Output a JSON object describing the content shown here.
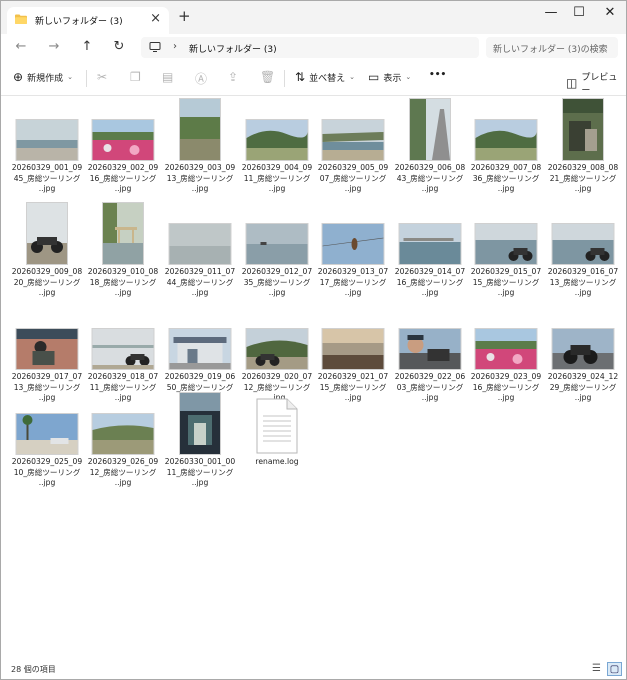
{
  "window": {
    "tab_title": "新しいフォルダー (3)",
    "new_tab": "+",
    "controls": {
      "minimize": "—",
      "maximize": "☐",
      "close": "✕"
    }
  },
  "address": {
    "breadcrumb": "新しいフォルダー (3)",
    "search_placeholder": "新しいフォルダー (3)の検索"
  },
  "toolbar": {
    "new_label": "新規作成",
    "sort_label": "並べ替え",
    "view_label": "表示",
    "more_label": "•••",
    "preview_label": "プレビュー"
  },
  "files": [
    {
      "l1": "20260329_001_0",
      "l2": "945_房総ツーリング",
      "ext": "..jpg",
      "kind": "sea"
    },
    {
      "l1": "20260329_002_0",
      "l2": "916_房総ツーリング",
      "ext": "..jpg",
      "kind": "flowers"
    },
    {
      "l1": "20260329_003_0",
      "l2": "913_房総ツーリング",
      "ext": "..jpg",
      "kind": "green-tall"
    },
    {
      "l1": "20260329_004_0",
      "l2": "911_房総ツーリング",
      "ext": "..jpg",
      "kind": "hills"
    },
    {
      "l1": "20260329_005_0",
      "l2": "907_房総ツーリング",
      "ext": "..jpg",
      "kind": "river"
    },
    {
      "l1": "20260329_006_0",
      "l2": "843_房総ツーリング",
      "ext": "..jpg",
      "kind": "road-tall"
    },
    {
      "l1": "20260329_007_0",
      "l2": "836_房総ツーリング",
      "ext": "..jpg",
      "kind": "hills"
    },
    {
      "l1": "20260329_008_0",
      "l2": "821_房総ツーリング",
      "ext": "..jpg",
      "kind": "tunnel-tall"
    },
    {
      "l1": "20260329_009_0",
      "l2": "820_房総ツーリング",
      "ext": "..jpg",
      "kind": "bike-tall"
    },
    {
      "l1": "20260329_010_0",
      "l2": "818_房総ツーリング",
      "ext": "..jpg",
      "kind": "torii-tall"
    },
    {
      "l1": "20260329_011_0",
      "l2": "744_房総ツーリング",
      "ext": "..jpg",
      "kind": "haze"
    },
    {
      "l1": "20260329_012_0",
      "l2": "735_房総ツーリング",
      "ext": "..jpg",
      "kind": "haze-ship"
    },
    {
      "l1": "20260329_013_0",
      "l2": "717_房総ツーリング",
      "ext": "..jpg",
      "kind": "bird"
    },
    {
      "l1": "20260329_014_0",
      "l2": "716_房総ツーリング",
      "ext": "..jpg",
      "kind": "harbor"
    },
    {
      "l1": "20260329_015_0",
      "l2": "715_房総ツーリング",
      "ext": "..jpg",
      "kind": "harbor-bike"
    },
    {
      "l1": "20260329_016_0",
      "l2": "713_房総ツーリング",
      "ext": "..jpg",
      "kind": "harbor-bike"
    },
    {
      "l1": "20260329_017_0",
      "l2": "713_房総ツーリング",
      "ext": "..jpg",
      "kind": "rider"
    },
    {
      "l1": "20260329_018_0",
      "l2": "711_房総ツーリング",
      "ext": "..jpg",
      "kind": "bike-bridge"
    },
    {
      "l1": "20260329_019_0",
      "l2": "650_房総ツーリング",
      "ext": "..jpg",
      "kind": "building"
    },
    {
      "l1": "20260329_020_0",
      "l2": "712_房総ツーリング",
      "ext": "..jpg",
      "kind": "bike-hills"
    },
    {
      "l1": "20260329_021_0",
      "l2": "715_房総ツーリング",
      "ext": "..jpg",
      "kind": "beach"
    },
    {
      "l1": "20260329_022_0",
      "l2": "603_房総ツーリング",
      "ext": "..jpg",
      "kind": "selfie"
    },
    {
      "l1": "20260329_023_0",
      "l2": "916_房総ツーリング",
      "ext": "..jpg",
      "kind": "flowers"
    },
    {
      "l1": "20260329_024_1",
      "l2": "229_房総ツーリング",
      "ext": "..jpg",
      "kind": "bike-lot"
    },
    {
      "l1": "20260329_025_0",
      "l2": "910_房総ツーリング",
      "ext": "..jpg",
      "kind": "palms"
    },
    {
      "l1": "20260329_026_0",
      "l2": "912_房総ツーリング",
      "ext": "..jpg",
      "kind": "village"
    },
    {
      "l1": "20260330_001_0",
      "l2": "011_房総ツーリング",
      "ext": "..jpg",
      "kind": "night-tall"
    },
    {
      "l1": "rename.log",
      "l2": "",
      "ext": "",
      "kind": "doc"
    }
  ],
  "status": {
    "count": "28 個の項目"
  },
  "colors": {
    "accent": "#0a64c8",
    "folder": "#f2c04b"
  }
}
